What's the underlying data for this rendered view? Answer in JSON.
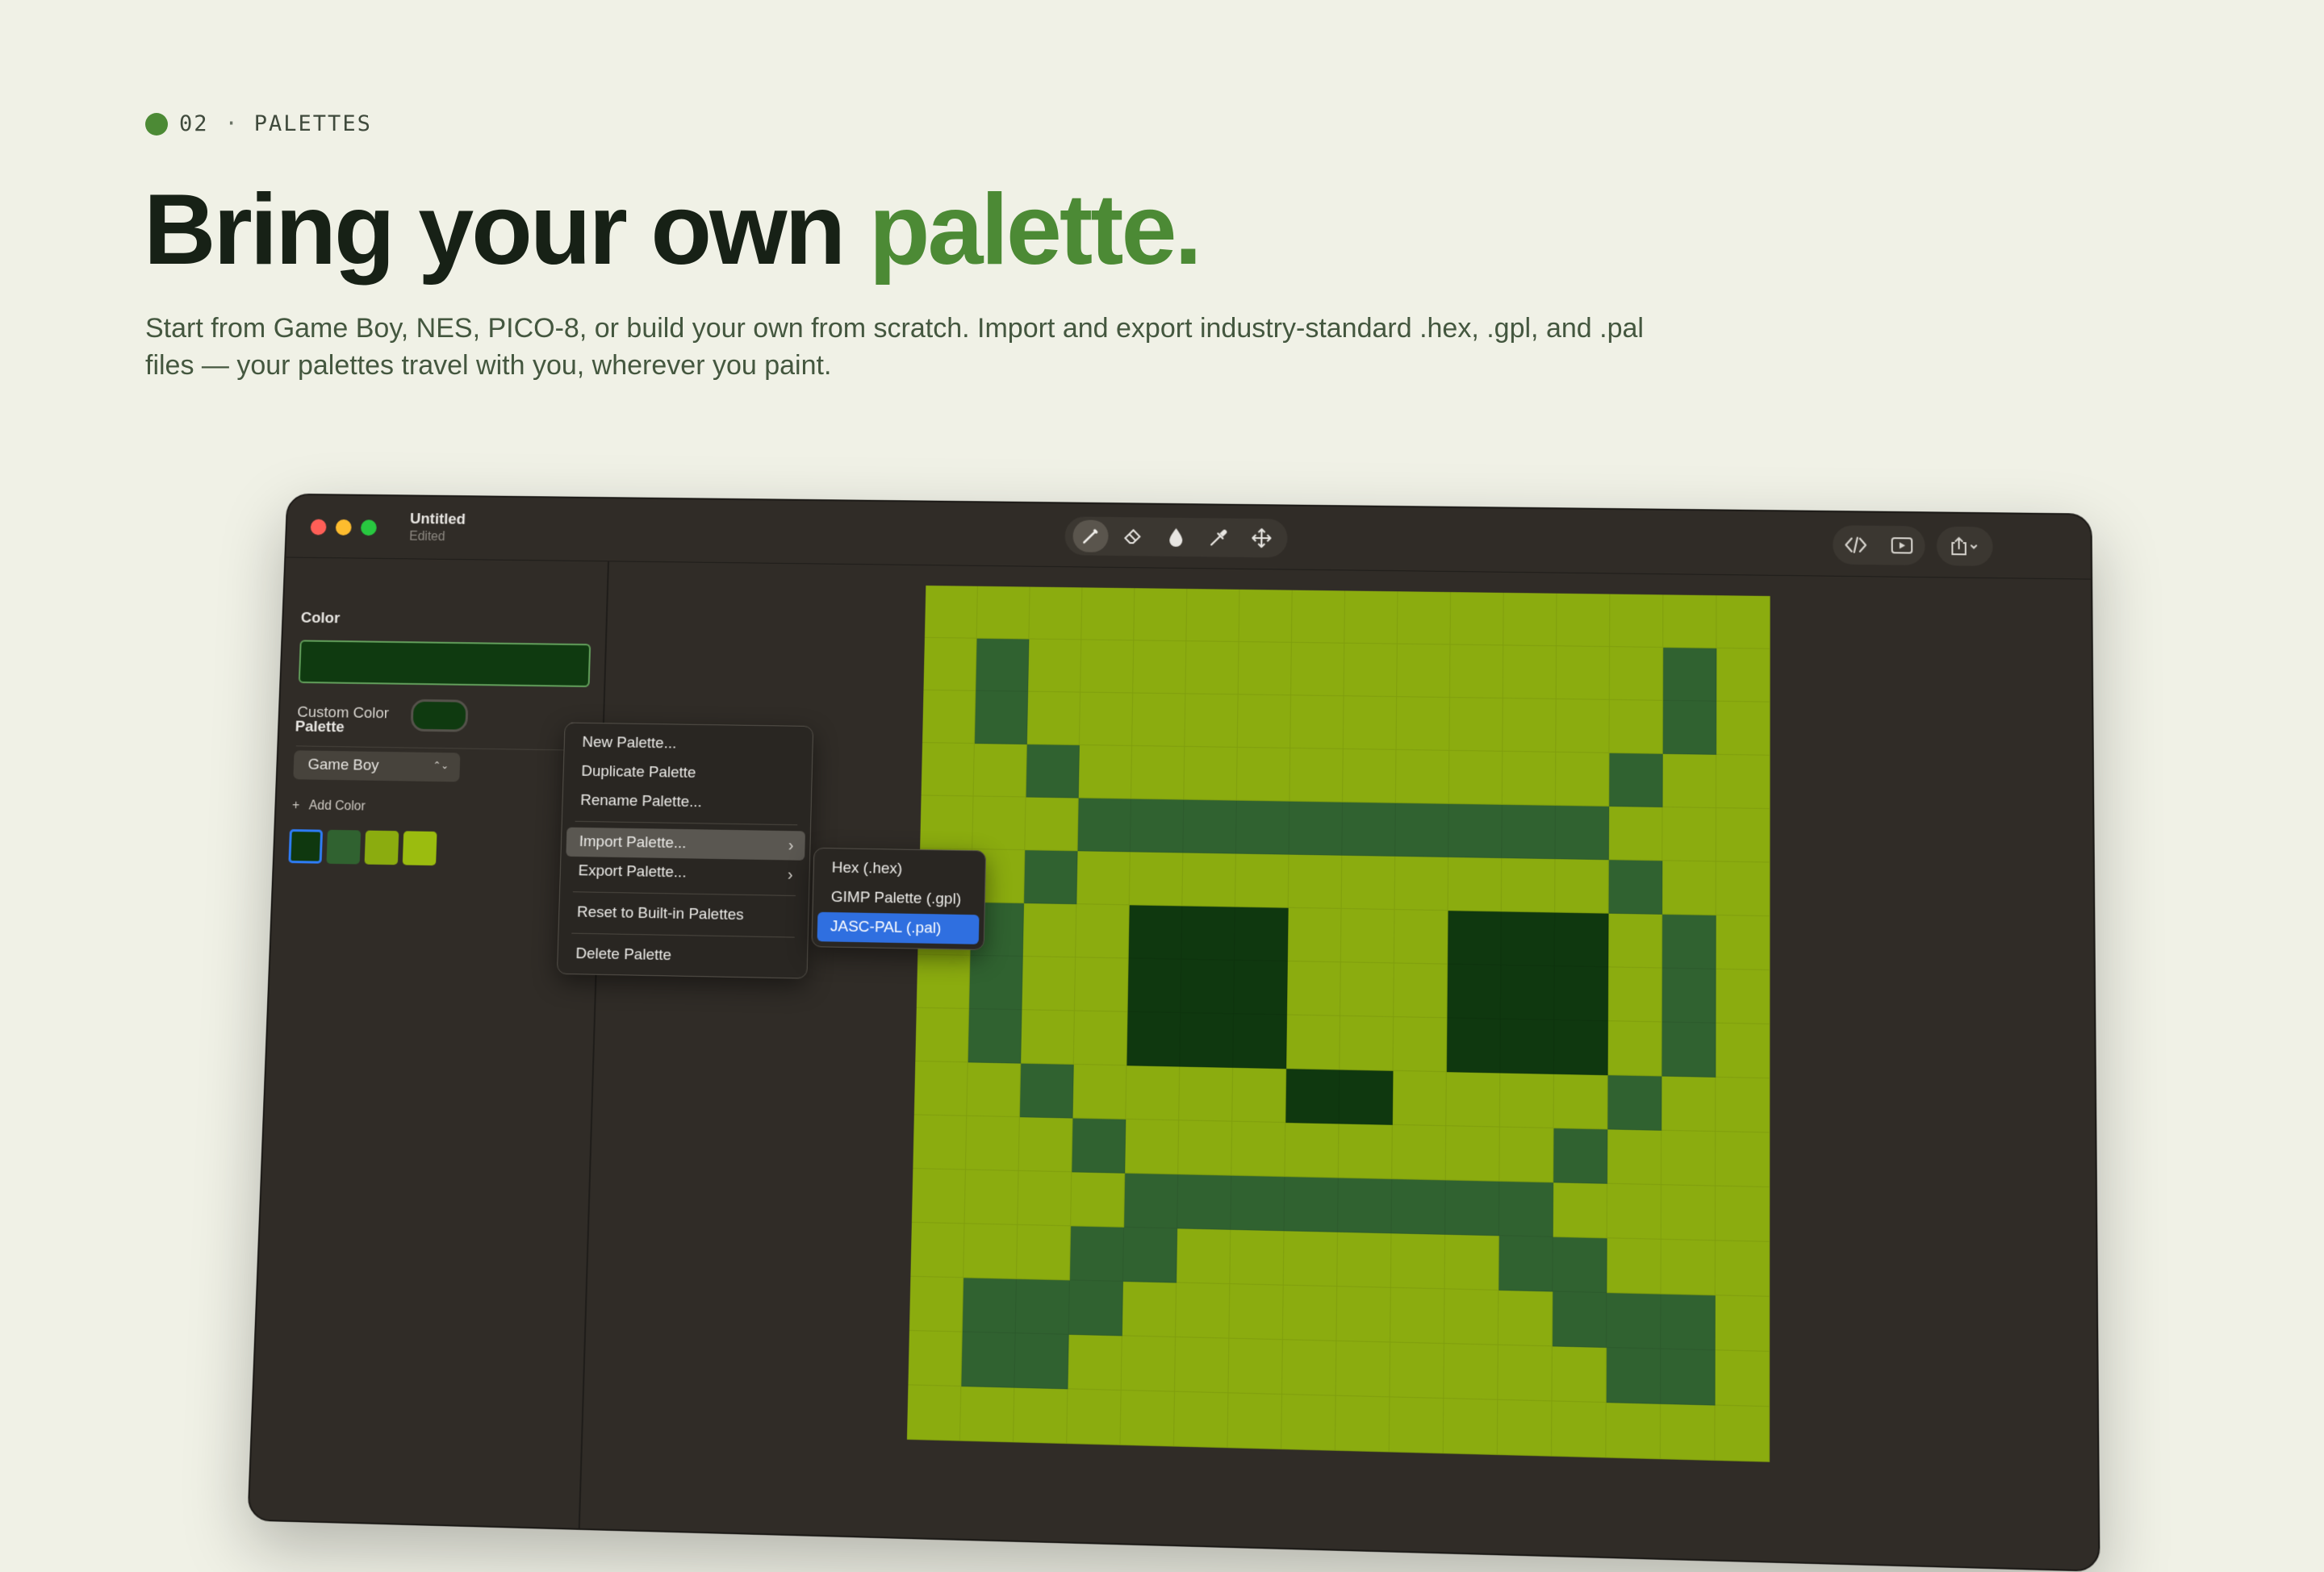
{
  "header": {
    "section_number": "02",
    "section_separator": "·",
    "section_name": "PALETTES",
    "headline_main": "Bring your own ",
    "headline_accent": "palette.",
    "description": "Start from Game Boy, NES, PICO-8, or build your own from scratch. Import and export industry-standard .hex, .gpl, and .pal files — your palettes travel with you, wherever you paint."
  },
  "window": {
    "title": "Untitled",
    "subtitle": "Edited",
    "toolbar": {
      "tools": [
        {
          "icon": "pencil-icon",
          "active": true
        },
        {
          "icon": "eraser-icon",
          "active": false
        },
        {
          "icon": "fill-drop-icon",
          "active": false
        },
        {
          "icon": "eyedropper-icon",
          "active": false
        },
        {
          "icon": "move-icon",
          "active": false
        }
      ],
      "right_icons": [
        "code-icon",
        "play-preview-icon",
        "share-icon"
      ]
    }
  },
  "sidebar": {
    "color_label": "Color",
    "current_color": "#0f3a10",
    "custom_color_label": "Custom Color",
    "palette_label": "Palette",
    "palette_selected": "Game Boy",
    "popup_chevron": "⌃⌄",
    "add_color_icon": "+",
    "add_color_label": "Add Color",
    "swatches": [
      "#0f380f",
      "#306230",
      "#8bac0f",
      "#9bbc0f"
    ]
  },
  "menu": {
    "items": [
      "New Palette...",
      "Duplicate Palette",
      "Rename Palette...",
      "Import Palette...",
      "Export Palette...",
      "Reset to Built-in Palettes",
      "Delete Palette"
    ],
    "submenu_arrow": "›",
    "submenu": [
      "Hex (.hex)",
      "GIMP Palette (.gpl)",
      "JASC-PAL (.pal)"
    ]
  },
  "canvas": {
    "size": 16,
    "palette": [
      "#0f380f",
      "#306230",
      "#8bac0f"
    ],
    "pixels": [
      "2222222222222222",
      "2122222222222212",
      "2122222222222212",
      "2212222222222122",
      "2221111111111222",
      "2212222222222122",
      "2122000222000212",
      "2122000222000212",
      "2122000222000212",
      "2212222002222122",
      "2221222222221222",
      "2222111111112222",
      "2221122222211222",
      "2111222222221112",
      "2112222222222112",
      "2222222222222222"
    ]
  }
}
